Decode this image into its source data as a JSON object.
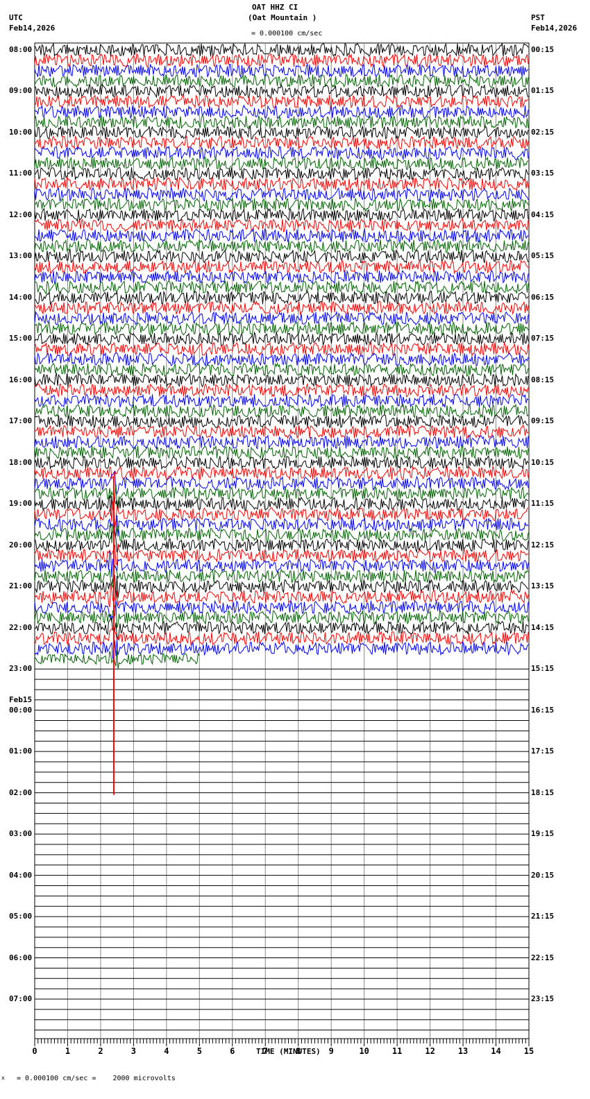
{
  "header": {
    "title": "OAT HHZ CI",
    "subtitle": "(Oat Mountain )",
    "left_tz": "UTC",
    "left_date": "Feb14,2026",
    "right_tz": "PST",
    "right_date": "Feb14,2026",
    "scale_text": "= 0.000100 cm/sec"
  },
  "footer": {
    "scale_text": "= 0.000100 cm/sec =    2000 microvolts",
    "mark": "x"
  },
  "chart_data": {
    "type": "line",
    "title": "OAT HHZ CI (Oat Mountain )",
    "xlabel": "TIME (MINUTES)",
    "xlim": [
      0,
      15
    ],
    "x_ticks": [
      "0",
      "1",
      "2",
      "3",
      "4",
      "5",
      "6",
      "7",
      "8",
      "9",
      "10",
      "11",
      "12",
      "13",
      "14",
      "15"
    ],
    "traces_per_hour": 4,
    "total_traces": 96,
    "trace_colors": [
      "#000000",
      "#ff0000",
      "#0000ff",
      "#006400"
    ],
    "data_end": {
      "trace_index": 59,
      "minute": 5.0
    },
    "noisy_until_trace": 58,
    "event": {
      "minute": 2.4,
      "start_trace": 42,
      "end_trace": 72,
      "color": "#ff0000"
    },
    "left_labels": [
      "08:00",
      "09:00",
      "10:00",
      "11:00",
      "12:00",
      "13:00",
      "14:00",
      "15:00",
      "16:00",
      "17:00",
      "18:00",
      "19:00",
      "20:00",
      "21:00",
      "22:00",
      "23:00",
      "00:00",
      "01:00",
      "02:00",
      "03:00",
      "04:00",
      "05:00",
      "06:00",
      "07:00"
    ],
    "date_change_label": "Feb15",
    "right_labels": [
      "00:15",
      "01:15",
      "02:15",
      "03:15",
      "04:15",
      "05:15",
      "06:15",
      "07:15",
      "08:15",
      "09:15",
      "10:15",
      "11:15",
      "12:15",
      "13:15",
      "14:15",
      "15:15",
      "16:15",
      "17:15",
      "18:15",
      "19:15",
      "20:15",
      "21:15",
      "22:15",
      "23:15"
    ]
  }
}
